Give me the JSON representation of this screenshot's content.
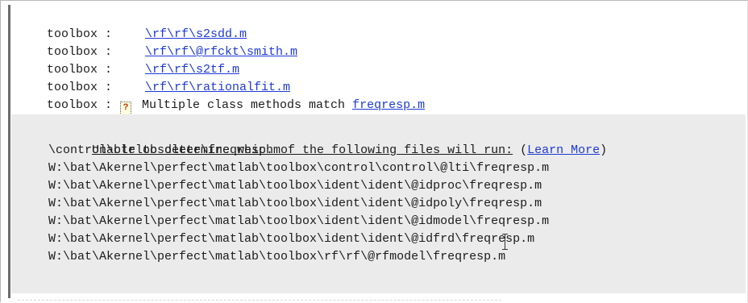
{
  "lines": [
    {
      "prefix": "toolbox :",
      "link": "\\rf\\rf\\s2sdd.m"
    },
    {
      "prefix": "toolbox :",
      "link": "\\rf\\rf\\@rfckt\\smith.m"
    },
    {
      "prefix": "toolbox :",
      "link": "\\rf\\rf\\s2tf.m"
    },
    {
      "prefix": "toolbox :",
      "link": "\\rf\\rf\\rationalfit.m"
    }
  ],
  "multi": {
    "prefix": "toolbox :",
    "icon": "?",
    "text": " Multiple class methods match ",
    "link": "freqresp.m"
  },
  "panel": {
    "heading": "Unable to determine which of the following files will run:",
    "open_paren": " (",
    "learn_more": "Learn More",
    "close_paren": ")",
    "files": [
      "\\control\\ctrlobsolete\\freqresp.m",
      "W:\\bat\\Akernel\\perfect\\matlab\\toolbox\\control\\control\\@lti\\freqresp.m",
      "W:\\bat\\Akernel\\perfect\\matlab\\toolbox\\ident\\ident\\@idproc\\freqresp.m",
      "W:\\bat\\Akernel\\perfect\\matlab\\toolbox\\ident\\ident\\@idpoly\\freqresp.m",
      "W:\\bat\\Akernel\\perfect\\matlab\\toolbox\\ident\\ident\\@idmodel\\freqresp.m",
      "W:\\bat\\Akernel\\perfect\\matlab\\toolbox\\ident\\ident\\@idfrd\\freqresp.m",
      "W:\\bat\\Akernel\\perfect\\matlab\\toolbox\\rf\\rf\\@rfmodel\\freqresp.m"
    ]
  }
}
